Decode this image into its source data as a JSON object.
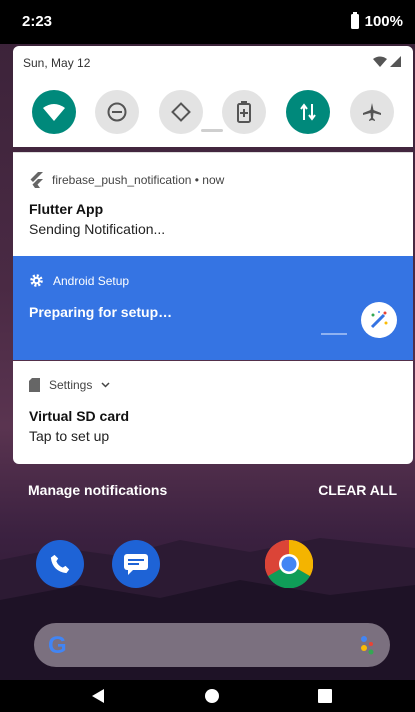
{
  "status_bar": {
    "time": "2:23",
    "battery": "100%"
  },
  "quick_settings": {
    "date": "Sun, May 12",
    "tiles": [
      {
        "name": "wifi",
        "icon": "wifi-icon",
        "active": true
      },
      {
        "name": "do-not-disturb",
        "icon": "do-not-disturb-icon",
        "active": false
      },
      {
        "name": "auto-rotate",
        "icon": "auto-rotate-icon",
        "active": false
      },
      {
        "name": "battery-saver",
        "icon": "battery-saver-icon",
        "active": false
      },
      {
        "name": "mobile-data",
        "icon": "data-transfer-icon",
        "active": true
      },
      {
        "name": "airplane-mode",
        "icon": "airplane-icon",
        "active": false
      }
    ]
  },
  "notifications": [
    {
      "app": "firebase_push_notification • now",
      "title": "Flutter App",
      "body": "Sending Notification...",
      "icon": "flutter-icon"
    },
    {
      "app": "Android Setup",
      "title": "Preparing for setup…",
      "icon": "gear-icon",
      "action_icon": "magic-wand-icon",
      "highlight_color": "#3574e3"
    },
    {
      "app": "Settings",
      "title": "Virtual SD card",
      "body": "Tap to set up",
      "icon": "sd-card-icon"
    }
  ],
  "footer": {
    "manage": "Manage notifications",
    "clear": "CLEAR ALL"
  },
  "home": {
    "dock": [
      {
        "name": "phone",
        "icon": "phone-icon"
      },
      {
        "name": "messages",
        "icon": "messages-icon"
      },
      {
        "name": "chrome",
        "icon": "chrome-icon"
      }
    ],
    "search": {
      "logo": "G",
      "icon": "assistant-mic-icon"
    }
  },
  "nav": [
    "back-icon",
    "home-icon",
    "recents-icon"
  ],
  "colors": {
    "accent": "#00897b",
    "notification_blue": "#3574e3"
  }
}
